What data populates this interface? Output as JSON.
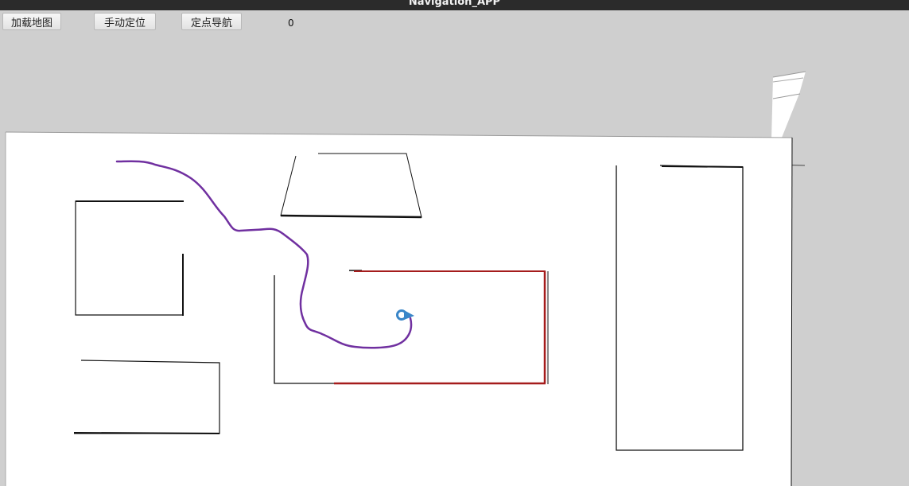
{
  "window": {
    "title": "Navigation_APP"
  },
  "toolbar": {
    "load_map_label": "加载地图",
    "manual_locate_label": "手动定位",
    "point_nav_label": "定点导航",
    "counter_value": "0"
  },
  "colors": {
    "background": "#cfcfcf",
    "map_free": "#ffffff",
    "obstacle": "#000000",
    "path": "#7030a0",
    "cost_outline": "#a51c1c",
    "robot_marker": "#3a86c8"
  }
}
